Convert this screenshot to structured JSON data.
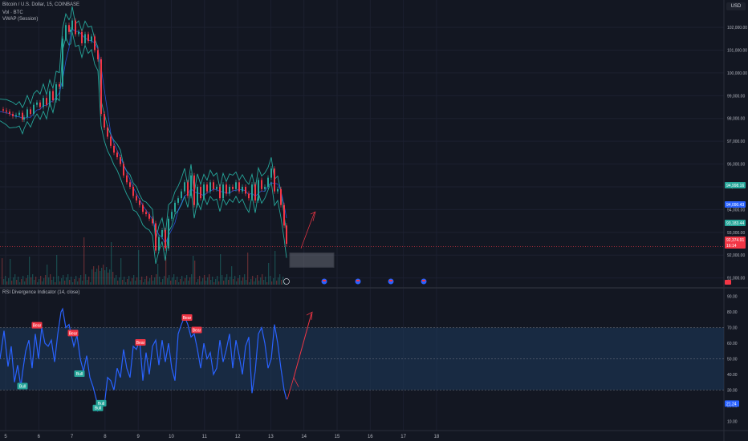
{
  "header": {
    "symbol": "Bitcoin / U.S. Dollar, 15, COINBASE",
    "volume_label": "Vol · BTC",
    "vwap_label": "VWAP (Session)",
    "currency": "USD"
  },
  "rsi_panel": {
    "title": "RSI Divergence Indicator (14, close)"
  },
  "chart_data": [
    {
      "type": "line",
      "name": "price",
      "x": [
        0,
        4,
        8,
        12,
        16,
        20,
        24,
        28,
        30,
        34,
        38,
        42,
        46,
        50,
        54,
        58,
        62,
        66,
        70,
        74,
        78,
        82,
        86,
        88,
        90,
        94,
        98,
        102,
        106,
        110,
        114,
        118,
        122,
        126,
        130,
        134,
        138,
        142,
        146,
        150,
        154,
        158,
        162,
        166,
        170,
        174,
        178,
        182,
        186,
        190,
        194,
        198,
        202,
        206,
        210,
        214,
        218,
        222,
        226,
        230,
        234,
        238,
        242,
        246,
        250,
        254,
        258,
        262,
        266,
        270,
        274,
        278,
        282,
        286,
        290,
        294,
        298,
        302,
        306,
        310,
        314,
        318,
        322,
        326,
        330,
        334,
        338,
        342,
        346,
        350,
        354,
        357
      ],
      "y": [
        98400,
        98350,
        98300,
        98200,
        98100,
        98150,
        98250,
        97950,
        98050,
        98400,
        98200,
        98600,
        98700,
        98500,
        98900,
        98600,
        99200,
        98800,
        99500,
        99400,
        101500,
        102100,
        101800,
        101900,
        102300,
        101700,
        101800,
        101300,
        101700,
        101400,
        101600,
        101000,
        100600,
        98200,
        97600,
        97200,
        96800,
        96500,
        96300,
        96000,
        95500,
        95200,
        95000,
        94600,
        94400,
        94200,
        93900,
        93800,
        93600,
        93400,
        92200,
        92800,
        93100,
        92300,
        93600,
        93900,
        94300,
        94500,
        94800,
        95200,
        94600,
        95500,
        94200,
        95000,
        94500,
        95100,
        94800,
        95200,
        94900,
        95000,
        94500,
        95100,
        94700,
        95000,
        94900,
        95200,
        94800,
        95000,
        94700,
        94500,
        95100,
        94400,
        95300,
        94900,
        95000,
        95400,
        95800,
        94800,
        94900,
        94200,
        93300,
        92500
      ],
      "yticks": [
        "102,000.00",
        "101,000.00",
        "100,000.00",
        "99,000.00",
        "98,000.00",
        "97,000.00",
        "96,000.00",
        "95,000.00",
        "94,000.00",
        "93,000.00",
        "92,000.00",
        "91,000.00"
      ],
      "ylim": [
        90600,
        103200
      ],
      "price_tags": [
        {
          "value": "94,998.16",
          "color": "#26a69a"
        },
        {
          "value": "94,090.43",
          "color": "#2962ff"
        },
        {
          "value": "93,183.44",
          "color": "#26a69a"
        },
        {
          "value": "92,374.91",
          "color": "#f23645"
        },
        {
          "value": "16:14",
          "color": "#f23645"
        }
      ]
    },
    {
      "type": "line",
      "name": "rsi",
      "x": [
        0,
        5,
        10,
        14,
        18,
        22,
        26,
        28,
        32,
        36,
        40,
        44,
        48,
        52,
        56,
        60,
        64,
        68,
        72,
        76,
        78,
        82,
        86,
        88,
        92,
        96,
        100,
        104,
        108,
        112,
        116,
        120,
        122,
        126,
        130,
        134,
        138,
        142,
        146,
        150,
        154,
        158,
        162,
        166,
        170,
        174,
        178,
        182,
        186,
        190,
        194,
        198,
        202,
        206,
        210,
        214,
        218,
        222,
        226,
        230,
        234,
        238,
        242,
        246,
        250,
        254,
        258,
        262,
        266,
        270,
        274,
        278,
        282,
        286,
        290,
        294,
        298,
        302,
        306,
        310,
        314,
        318,
        322,
        326,
        330,
        334,
        338,
        342,
        346,
        350,
        354,
        357
      ],
      "y": [
        50,
        68,
        45,
        58,
        35,
        46,
        32,
        41,
        55,
        62,
        44,
        66,
        50,
        70,
        60,
        58,
        62,
        48,
        66,
        80,
        82,
        70,
        72,
        67,
        58,
        65,
        50,
        42,
        52,
        38,
        32,
        24,
        17,
        22,
        20,
        38,
        36,
        30,
        44,
        38,
        56,
        44,
        38,
        58,
        56,
        62,
        36,
        54,
        40,
        58,
        62,
        46,
        62,
        48,
        60,
        44,
        36,
        66,
        72,
        77,
        72,
        64,
        66,
        56,
        44,
        60,
        50,
        54,
        40,
        44,
        62,
        48,
        56,
        66,
        44,
        62,
        52,
        40,
        58,
        64,
        28,
        42,
        66,
        70,
        60,
        44,
        50,
        72,
        60,
        44,
        30,
        24
      ],
      "yticks": [
        "90.00",
        "80.00",
        "70.00",
        "60.00",
        "50.00",
        "40.00",
        "30.00",
        "20.00",
        "10.00"
      ],
      "ylim": [
        5,
        95
      ],
      "current_value": "21.24",
      "labels": [
        {
          "text": "Bear",
          "x": 46,
          "y": 71
        },
        {
          "text": "Bear",
          "x": 91,
          "y": 66
        },
        {
          "text": "Bear",
          "x": 175,
          "y": 60
        },
        {
          "text": "Bear",
          "x": 233,
          "y": 76
        },
        {
          "text": "Bear",
          "x": 245,
          "y": 68
        },
        {
          "text": "Bull",
          "x": 28,
          "y": 32
        },
        {
          "text": "Bull",
          "x": 99,
          "y": 40
        },
        {
          "text": "Bull",
          "x": 126,
          "y": 21
        },
        {
          "text": "Bull",
          "x": 122,
          "y": 18
        }
      ]
    }
  ],
  "xaxis": {
    "ticks": [
      "5",
      "6",
      "7",
      "8",
      "9",
      "10",
      "11",
      "12",
      "13",
      "14",
      "15",
      "16",
      "17",
      "18"
    ]
  },
  "colors": {
    "background": "#131722",
    "rsi_line": "#2962ff",
    "rsi_band": "#1d3a5c",
    "bull": "#26a69a",
    "bear": "#f23645",
    "envelope": "#26a69a",
    "vwap": "#2962ff",
    "projection": "#f23645"
  },
  "event_markers": {
    "icon": "earnings-flag-icon",
    "dividend_icon": "dividend-icon"
  }
}
